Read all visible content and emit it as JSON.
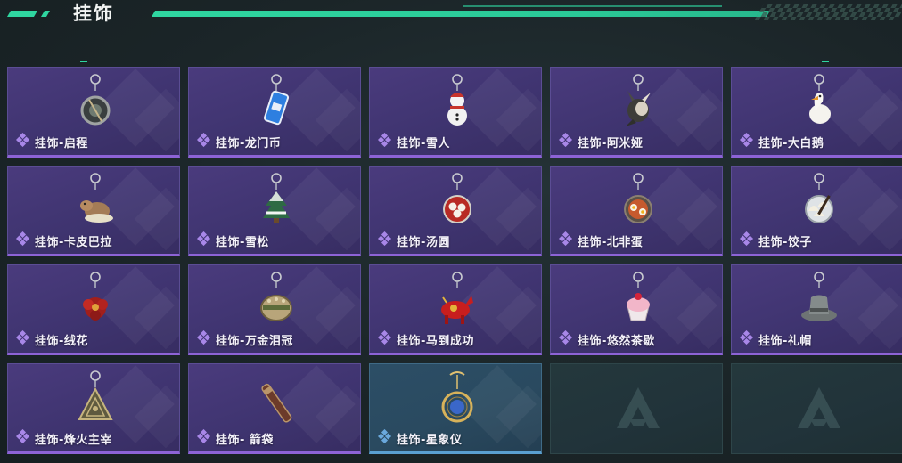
{
  "header": {
    "title": "挂饰"
  },
  "colors": {
    "accent": "#2fd6a0",
    "card_purple": "#4a3b7d",
    "card_purple_border": "#8d63d6",
    "card_blue": "#2c4e66",
    "card_blue_border": "#5a9fd0",
    "empty_slot": "#24383c"
  },
  "items": [
    {
      "label": "挂饰-启程",
      "icon": "compass-ring-charm-icon",
      "rarity": "purple"
    },
    {
      "label": "挂饰-龙门币",
      "icon": "coin-card-charm-icon",
      "rarity": "purple"
    },
    {
      "label": "挂饰-雪人",
      "icon": "snowman-charm-icon",
      "rarity": "purple"
    },
    {
      "label": "挂饰-阿米娅",
      "icon": "bunny-charm-icon",
      "rarity": "purple"
    },
    {
      "label": "挂饰-大白鹅",
      "icon": "goose-charm-icon",
      "rarity": "purple"
    },
    {
      "label": "挂饰-卡皮巴拉",
      "icon": "capybara-charm-icon",
      "rarity": "purple"
    },
    {
      "label": "挂饰-雪松",
      "icon": "snow-pine-charm-icon",
      "rarity": "purple"
    },
    {
      "label": "挂饰-汤圆",
      "icon": "dumpling-bowl-charm-icon",
      "rarity": "purple"
    },
    {
      "label": "挂饰-北非蛋",
      "icon": "shakshuka-charm-icon",
      "rarity": "purple"
    },
    {
      "label": "挂饰-饺子",
      "icon": "jiaozi-plate-charm-icon",
      "rarity": "purple"
    },
    {
      "label": "挂饰-绒花",
      "icon": "velvet-flower-charm-icon",
      "rarity": "purple"
    },
    {
      "label": "挂饰-万金泪冠",
      "icon": "crown-charm-icon",
      "rarity": "purple"
    },
    {
      "label": "挂饰-马到成功",
      "icon": "red-horse-charm-icon",
      "rarity": "purple"
    },
    {
      "label": "挂饰-悠然茶歇",
      "icon": "cupcake-charm-icon",
      "rarity": "purple"
    },
    {
      "label": "挂饰-礼帽",
      "icon": "top-hat-charm-icon",
      "rarity": "purple"
    },
    {
      "label": "挂饰-烽火主宰",
      "icon": "pyramid-charm-icon",
      "rarity": "purple"
    },
    {
      "label": "挂饰- 箭袋",
      "icon": "quiver-charm-icon",
      "rarity": "purple"
    },
    {
      "label": "挂饰-星象仪",
      "icon": "astrolabe-charm-icon",
      "rarity": "blue"
    }
  ],
  "empty_slots": [
    {
      "icon": "game-logo-icon"
    },
    {
      "icon": "game-logo-icon"
    }
  ]
}
